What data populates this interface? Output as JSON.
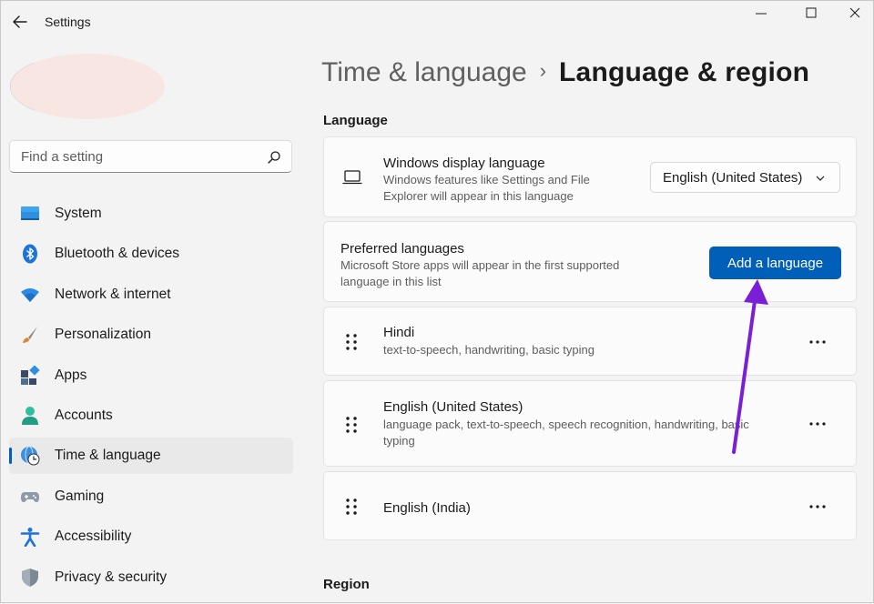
{
  "window": {
    "title": "Settings",
    "accent": "#005fb8",
    "arrow_color": "#7a1fd6"
  },
  "search": {
    "placeholder": "Find a setting"
  },
  "sidebar": {
    "items": [
      {
        "label": "System",
        "icon": "monitor-icon",
        "active": false
      },
      {
        "label": "Bluetooth & devices",
        "icon": "bluetooth-icon",
        "active": false
      },
      {
        "label": "Network & internet",
        "icon": "wifi-icon",
        "active": false
      },
      {
        "label": "Personalization",
        "icon": "brush-icon",
        "active": false
      },
      {
        "label": "Apps",
        "icon": "apps-icon",
        "active": false
      },
      {
        "label": "Accounts",
        "icon": "account-icon",
        "active": false
      },
      {
        "label": "Time & language",
        "icon": "globe-clock-icon",
        "active": true
      },
      {
        "label": "Gaming",
        "icon": "gamepad-icon",
        "active": false
      },
      {
        "label": "Accessibility",
        "icon": "accessibility-icon",
        "active": false
      },
      {
        "label": "Privacy & security",
        "icon": "shield-icon",
        "active": false
      }
    ]
  },
  "breadcrumb": {
    "parent": "Time & language",
    "separator": "›",
    "current": "Language & region"
  },
  "language_section": {
    "header": "Language",
    "display_language": {
      "title": "Windows display language",
      "description": "Windows features like Settings and File Explorer will appear in this language",
      "selected": "English (United States)"
    },
    "preferred": {
      "title": "Preferred languages",
      "description": "Microsoft Store apps will appear in the first supported language in this list",
      "button": "Add a language"
    },
    "languages": [
      {
        "name": "Hindi",
        "features": "text-to-speech, handwriting, basic typing"
      },
      {
        "name": "English (United States)",
        "features": "language pack, text-to-speech, speech recognition, handwriting, basic typing"
      },
      {
        "name": "English (India)",
        "features": ""
      }
    ]
  },
  "region_section": {
    "header": "Region"
  }
}
